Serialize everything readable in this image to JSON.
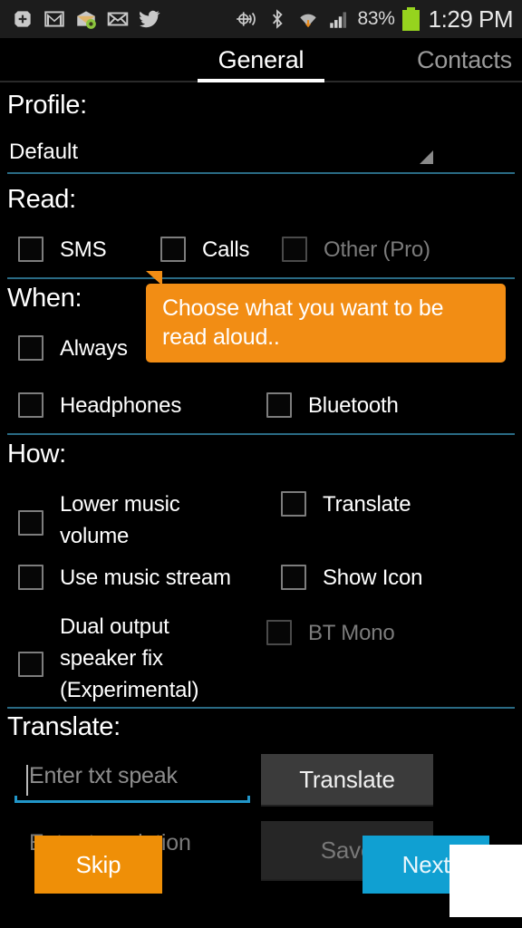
{
  "statusbar": {
    "battery_percent": "83%",
    "clock": "1:29 PM",
    "left_icons": [
      "plus-badge-icon",
      "gmail-icon",
      "email-attachment-icon",
      "mail-icon",
      "twitter-icon"
    ],
    "right_icons": [
      "gps-location-icon",
      "bluetooth-icon",
      "wifi-download-icon",
      "cell-signal-icon",
      "battery-icon"
    ],
    "battery_color": "#96d41e"
  },
  "tabs": [
    {
      "label": "General",
      "selected": true
    },
    {
      "label": "Contacts",
      "selected": false
    }
  ],
  "sections": {
    "profile": {
      "title": "Profile:",
      "selected_value": "Default"
    },
    "read": {
      "title": "Read:",
      "options": [
        {
          "label": "SMS",
          "checked": false,
          "disabled": false
        },
        {
          "label": "Calls",
          "checked": false,
          "disabled": false
        },
        {
          "label": "Other (Pro)",
          "checked": false,
          "disabled": true
        }
      ]
    },
    "when": {
      "title": "When:",
      "options": [
        {
          "label": "Always",
          "checked": false,
          "disabled": false
        },
        {
          "label": "Headphones",
          "checked": false,
          "disabled": false
        },
        {
          "label": "Bluetooth",
          "checked": false,
          "disabled": false
        }
      ]
    },
    "how": {
      "title": "How:",
      "options": [
        {
          "label": "Lower music volume",
          "checked": false,
          "disabled": false
        },
        {
          "label": "Translate",
          "checked": false,
          "disabled": false
        },
        {
          "label": "Use music stream",
          "checked": false,
          "disabled": false
        },
        {
          "label": "Show Icon",
          "checked": false,
          "disabled": false
        },
        {
          "label": "Dual output speaker fix (Experimental)",
          "checked": false,
          "disabled": false
        },
        {
          "label": "BT Mono",
          "checked": false,
          "disabled": true
        }
      ]
    },
    "translate": {
      "title": "Translate:",
      "input_placeholder": "Enter txt speak",
      "input_value": "",
      "translate_button": "Translate",
      "result_placeholder": "Enter translation",
      "save_button": "Save"
    }
  },
  "tooltip": {
    "text": "Choose what you want to be read aloud..",
    "background": "#f28d14"
  },
  "wizard": {
    "skip_button": "Skip",
    "next_button": "Next",
    "skip_color": "#ef8f07",
    "next_color": "#10a0d2"
  },
  "theme": {
    "background": "#000000",
    "divider": "#2a6b85",
    "accent": "#33b5e5",
    "disabled_text": "#7b7b7b"
  }
}
